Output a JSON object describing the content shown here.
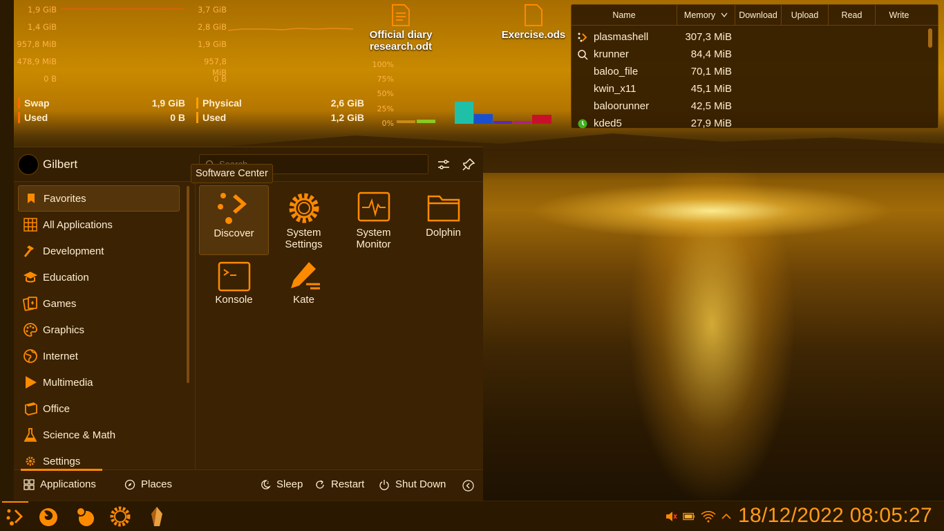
{
  "memory_widget": {
    "swap_axis": [
      "1,9 GiB",
      "1,4 GiB",
      "957,8 MiB",
      "478,9 MiB",
      "0 B"
    ],
    "physical_axis": [
      "3,7 GiB",
      "2,8 GiB",
      "1,9 GiB",
      "957,8 MiB",
      "0 B"
    ],
    "legend_swap": {
      "label": "Swap",
      "value": "1,9 GiB"
    },
    "legend_swap_used": {
      "label": "Used",
      "value": "0 B"
    },
    "legend_physical": {
      "label": "Physical",
      "value": "2,6 GiB"
    },
    "legend_physical_used": {
      "label": "Used",
      "value": "1,2 GiB"
    }
  },
  "cpu_widget": {
    "axis": [
      "100%",
      "75%",
      "50%",
      "25%",
      "0%"
    ]
  },
  "desktop": {
    "icons": [
      {
        "label": "Official diary research.odt"
      },
      {
        "label": "Exercise.ods"
      }
    ]
  },
  "process_table": {
    "headers": [
      "Name",
      "Memory",
      "Download",
      "Upload",
      "Read",
      "Write"
    ],
    "rows": [
      {
        "name": "plasmashell",
        "memory": "307,3 MiB",
        "icon": "plasma-icon"
      },
      {
        "name": "krunner",
        "memory": "84,4 MiB",
        "icon": "search-icon"
      },
      {
        "name": "baloo_file",
        "memory": "70,1 MiB",
        "icon": ""
      },
      {
        "name": "kwin_x11",
        "memory": "45,1 MiB",
        "icon": ""
      },
      {
        "name": "baloorunner",
        "memory": "42,5 MiB",
        "icon": ""
      },
      {
        "name": "kded5",
        "memory": "27,9 MiB",
        "icon": "kded-icon"
      }
    ]
  },
  "launcher": {
    "username": "Gilbert",
    "search_placeholder": "Search...",
    "tooltip": "Software Center",
    "categories": [
      {
        "label": "Favorites",
        "icon": "bookmark-icon"
      },
      {
        "label": "All Applications",
        "icon": "grid-icon"
      },
      {
        "label": "Development",
        "icon": "hammer-icon"
      },
      {
        "label": "Education",
        "icon": "graduation-cap-icon"
      },
      {
        "label": "Games",
        "icon": "cards-icon"
      },
      {
        "label": "Graphics",
        "icon": "palette-icon"
      },
      {
        "label": "Internet",
        "icon": "globe-icon"
      },
      {
        "label": "Multimedia",
        "icon": "play-icon"
      },
      {
        "label": "Office",
        "icon": "book-icon"
      },
      {
        "label": "Science & Math",
        "icon": "flask-icon"
      },
      {
        "label": "Settings",
        "icon": "gear-icon"
      }
    ],
    "apps": [
      {
        "label": "Discover",
        "icon": "discover-icon"
      },
      {
        "label": "System Settings",
        "icon": "settings-icon"
      },
      {
        "label": "System Monitor",
        "icon": "monitor-icon"
      },
      {
        "label": "Dolphin",
        "icon": "folder-icon"
      },
      {
        "label": "Konsole",
        "icon": "terminal-icon"
      },
      {
        "label": "Kate",
        "icon": "kate-icon"
      }
    ],
    "bottom": {
      "applications": "Applications",
      "places": "Places",
      "sleep": "Sleep",
      "restart": "Restart",
      "shutdown": "Shut Down"
    }
  },
  "taskbar": {
    "clock": "18/12/2022 08:05:27"
  },
  "colors": {
    "accent": "#ff8a00",
    "panel": "#3a2203",
    "text": "#ffeed0"
  }
}
